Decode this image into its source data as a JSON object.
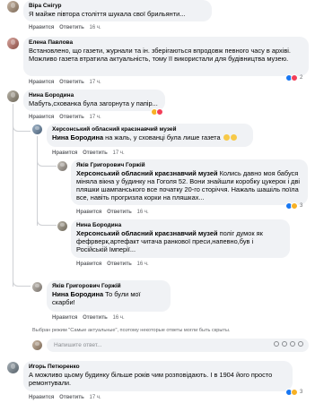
{
  "comments": [
    {
      "author": "Віра Снігур",
      "text": "Я майже півтора століття шукала свої брильянти...",
      "time": "16 ч.",
      "like": "Нравится",
      "reply": "Ответить"
    },
    {
      "author": "Елена Павлова",
      "text": "Встановлено, що газети, журнали та ін. зберігаються впродовж певного часу в архіві. Можливо газета втратила актуальність, тому її використали для будівництва музею.",
      "time": "17 ч.",
      "like": "Нравится",
      "reply": "Ответить",
      "reaction_count": "2"
    },
    {
      "author": "Нина Бородина",
      "text": "Мабуть,схованка була загорнута у папір...",
      "time": "17 ч.",
      "like": "Нравится",
      "reply": "Ответить"
    },
    {
      "author": "Херсонський обласний краєзнавчий музей",
      "mention": "Нина Бородина",
      "text": " на жаль, у схованці була лише газета",
      "time": "17 ч.",
      "like": "Нравится",
      "reply": "Ответить"
    },
    {
      "author": "Яків Григорович Горжій",
      "mention": "Херсонський обласний краєзнавчий музей",
      "text": " Колись давно моя бабуся міняла вікна у будинку на Гоголя 52. Вони знайшли коробку цукерок і дві пляшки шампанського все початку 20-го сторіччя. Нажаль шашіль поїла все, навіть прогризла корки на пляшках...",
      "time": "16 ч.",
      "like": "Нравится",
      "reply": "Ответить",
      "reaction_count": "3"
    },
    {
      "author": "Нина Бородина",
      "mention": "Херсонський обласний краєзнавчий музей",
      "text": " поліг думок як фефрверк,артефакт читача ранкової преси,напевно,був і Російській Імперії...",
      "time": "16 ч.",
      "like": "Нравится",
      "reply": "Ответить"
    },
    {
      "author": "Яків Григорович Горжій",
      "mention": "Нина Бородина",
      "text": " То були мої скарби!",
      "time": "16 ч.",
      "like": "Нравится",
      "reply": "Ответить"
    },
    {
      "author": "Игорь Петюренко",
      "text": "А можливо цьому будинку більше років чим розповідають. І в 1904 його просто ремонтували.",
      "time": "17 ч.",
      "like": "Нравится",
      "reply": "Ответить",
      "reaction_count": "3"
    }
  ],
  "notice": "Выбран режим \"Самые актуальные\", поэтому некоторые ответы могли быть скрыты.",
  "reply_placeholder": "Напишите ответ...",
  "colors": {
    "bubble": "#f0f2f5",
    "meta": "#65676b",
    "like": "#1877f2"
  }
}
